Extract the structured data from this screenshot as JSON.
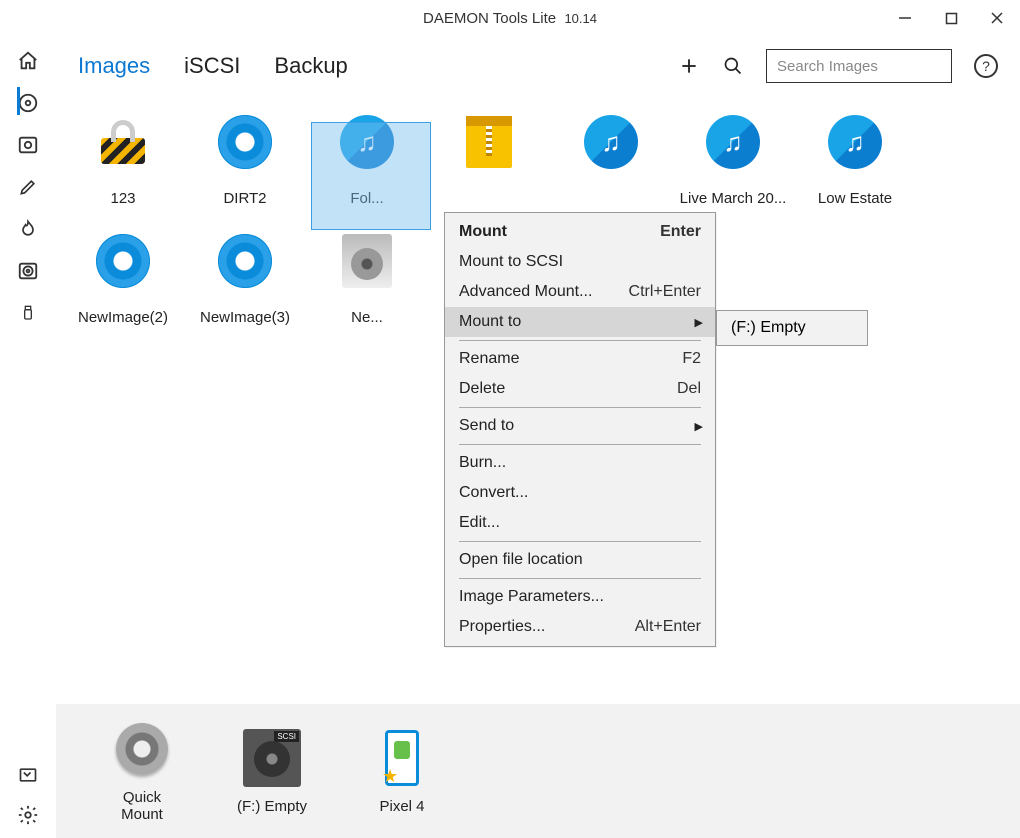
{
  "window": {
    "title": "DAEMON Tools Lite",
    "version": "10.14"
  },
  "sidebar": {
    "items": [
      {
        "name": "home-icon"
      },
      {
        "name": "disc-icon",
        "active": true
      },
      {
        "name": "image-catalog-icon"
      },
      {
        "name": "edit-icon"
      },
      {
        "name": "burn-icon"
      },
      {
        "name": "drive-icon"
      },
      {
        "name": "usb-icon"
      }
    ]
  },
  "tabs": {
    "items": [
      "Images",
      "iSCSI",
      "Backup"
    ],
    "active_index": 0
  },
  "toolbar": {
    "search_placeholder": "Search Images"
  },
  "grid": {
    "items": [
      {
        "label": "123",
        "icon": "lock"
      },
      {
        "label": "DIRT2",
        "icon": "disc"
      },
      {
        "label": "Fol...",
        "icon": "music",
        "selected": true
      },
      {
        "label": "",
        "icon": "zip"
      },
      {
        "label": "",
        "icon": "music"
      },
      {
        "label": "Live March 20...",
        "icon": "music"
      },
      {
        "label": "Low Estate",
        "icon": "music"
      },
      {
        "label": "NewImage(2)",
        "icon": "disc"
      },
      {
        "label": "NewImage(3)",
        "icon": "disc"
      },
      {
        "label": "Ne...",
        "icon": "nrg"
      },
      {
        "label": "",
        "icon": "hidden"
      },
      {
        "label": "...",
        "icon": "hidden"
      }
    ]
  },
  "context_menu": {
    "groups": [
      [
        {
          "label": "Mount",
          "shortcut": "Enter",
          "bold": true
        },
        {
          "label": "Mount to SCSI"
        },
        {
          "label": "Advanced Mount...",
          "shortcut": "Ctrl+Enter"
        },
        {
          "label": "Mount to",
          "submenu": true,
          "hover": true
        }
      ],
      [
        {
          "label": "Rename",
          "shortcut": "F2"
        },
        {
          "label": "Delete",
          "shortcut": "Del"
        }
      ],
      [
        {
          "label": "Send to",
          "submenu": true
        }
      ],
      [
        {
          "label": "Burn..."
        },
        {
          "label": "Convert..."
        },
        {
          "label": "Edit..."
        }
      ],
      [
        {
          "label": "Open file location"
        }
      ],
      [
        {
          "label": "Image Parameters..."
        },
        {
          "label": "Properties...",
          "shortcut": "Alt+Enter"
        }
      ]
    ],
    "submenu": {
      "items": [
        "(F:) Empty"
      ]
    }
  },
  "drives": {
    "items": [
      {
        "label": "Quick Mount",
        "icon": "qm"
      },
      {
        "label": "(F:) Empty",
        "icon": "scsi"
      },
      {
        "label": "Pixel 4",
        "icon": "pixel"
      }
    ]
  }
}
